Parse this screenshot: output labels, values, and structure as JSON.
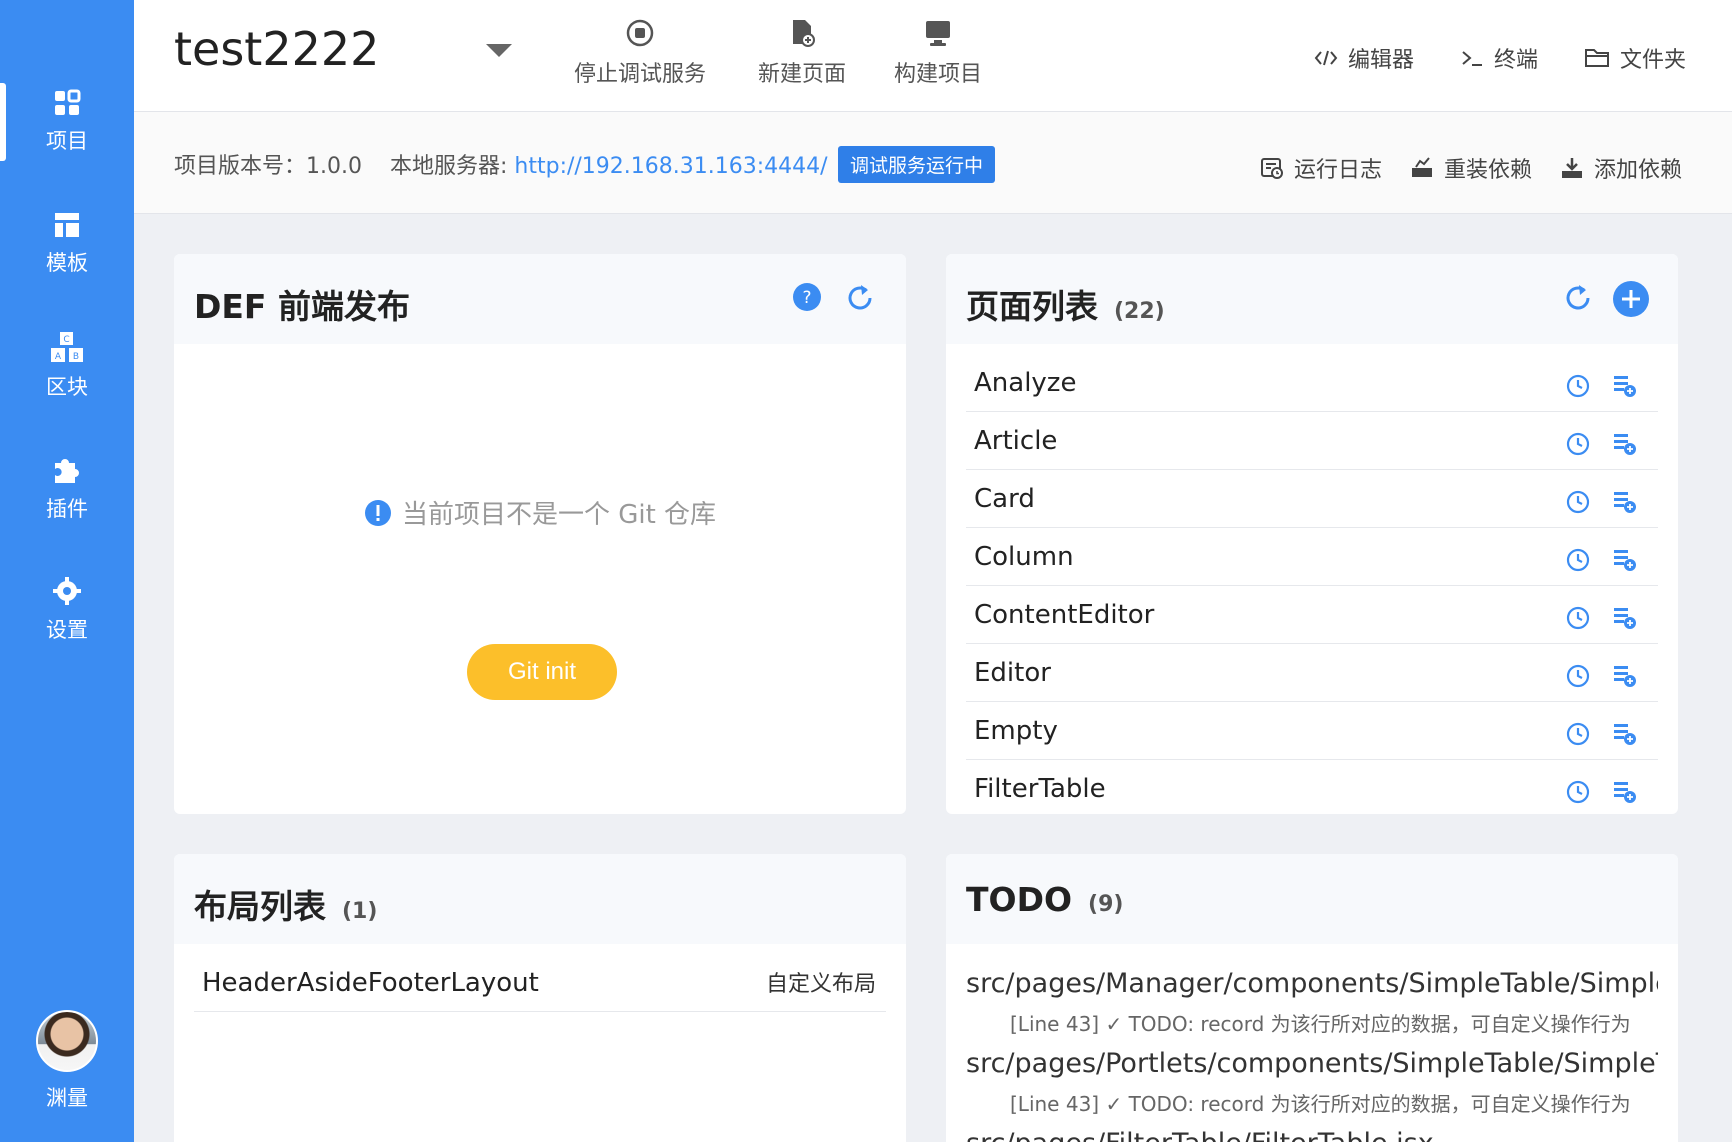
{
  "sidebar": {
    "items": [
      {
        "label": "项目",
        "icon": "dashboard-icon"
      },
      {
        "label": "模板",
        "icon": "template-icon"
      },
      {
        "label": "区块",
        "icon": "blocks-icon"
      },
      {
        "label": "插件",
        "icon": "puzzle-icon"
      },
      {
        "label": "设置",
        "icon": "gear-icon"
      }
    ],
    "user_name": "渊量"
  },
  "header": {
    "project_name": "test2222",
    "tools": [
      {
        "label": "停止调试服务",
        "icon": "stop-icon"
      },
      {
        "label": "新建页面",
        "icon": "new-page-icon"
      },
      {
        "label": "构建项目",
        "icon": "build-icon"
      }
    ],
    "right_tools": [
      {
        "label": "编辑器",
        "icon": "code-icon"
      },
      {
        "label": "终端",
        "icon": "terminal-icon"
      },
      {
        "label": "文件夹",
        "icon": "folder-icon"
      }
    ]
  },
  "info": {
    "version_label": "项目版本号：",
    "version": "1.0.0",
    "server_label": "本地服务器:",
    "server_url": "http://192.168.31.163:4444/",
    "status": "调试服务运行中",
    "actions": [
      {
        "label": "运行日志",
        "icon": "log-icon"
      },
      {
        "label": "重装依赖",
        "icon": "reinstall-icon"
      },
      {
        "label": "添加依赖",
        "icon": "download-icon"
      }
    ]
  },
  "def_panel": {
    "title": "DEF 前端发布",
    "empty_message": "当前项目不是一个 Git 仓库",
    "git_button": "Git init"
  },
  "pages_panel": {
    "title": "页面列表",
    "count": "(22)",
    "pages": [
      "Analyze",
      "Article",
      "Card",
      "Column",
      "ContentEditor",
      "Editor",
      "Empty",
      "FilterTable"
    ]
  },
  "layouts_panel": {
    "title": "布局列表",
    "count": "(1)",
    "layouts": [
      {
        "name": "HeaderAsideFooterLayout",
        "tag": "自定义布局"
      }
    ]
  },
  "todo_panel": {
    "title": "TODO",
    "count": "(9)",
    "items": [
      {
        "file": "src/pages/Manager/components/SimpleTable/SimpleTable.jsx",
        "line": "[Line 43] ✓ TODO: record 为该行所对应的数据，可自定义操作行为"
      },
      {
        "file": "src/pages/Portlets/components/SimpleTable/SimpleTable.jsx",
        "line": "[Line 43] ✓ TODO: record 为该行所对应的数据，可自定义操作行为"
      },
      {
        "file": "src/pages/FilterTable/FilterTable.jsx",
        "line": ""
      }
    ]
  },
  "colors": {
    "primary": "#3b8cf2",
    "accent": "#fcbf2a",
    "badge": "#2f7fe8"
  }
}
